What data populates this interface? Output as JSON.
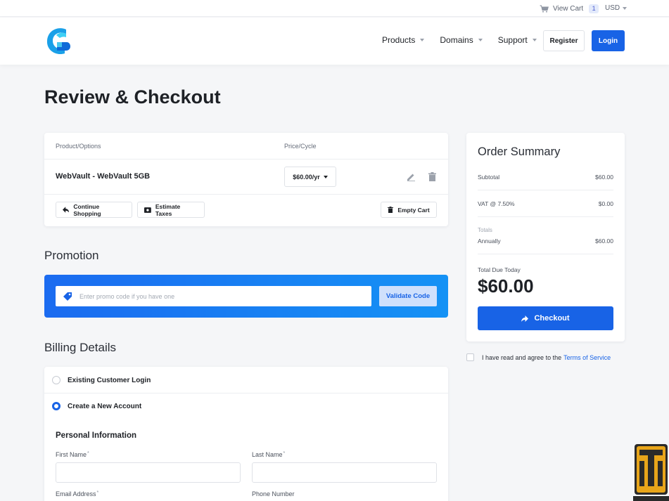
{
  "topbar": {
    "cart_label": "View Cart",
    "cart_count": "1",
    "currency": "USD"
  },
  "header": {
    "nav": [
      {
        "label": "Products"
      },
      {
        "label": "Domains"
      },
      {
        "label": "Support"
      }
    ],
    "register_label": "Register",
    "login_label": "Login"
  },
  "page": {
    "title": "Review & Checkout"
  },
  "cart": {
    "col_product": "Product/Options",
    "col_price": "Price/Cycle",
    "item_name": "WebVault - WebVault 5GB",
    "item_price": "$60.00/yr",
    "continue_label": "Continue Shopping",
    "estimate_label": "Estimate Taxes",
    "empty_label": "Empty Cart"
  },
  "promotion": {
    "title": "Promotion",
    "placeholder": "Enter promo code if you have one",
    "validate_label": "Validate Code"
  },
  "billing": {
    "title": "Billing Details",
    "existing_label": "Existing Customer Login",
    "new_label": "Create a New Account",
    "personal_title": "Personal Information",
    "first_name_label": "First Name",
    "last_name_label": "Last Name",
    "email_label": "Email Address",
    "phone_label": "Phone Number",
    "required_mark": "*"
  },
  "summary": {
    "title": "Order Summary",
    "subtotal_label": "Subtotal",
    "subtotal_value": "$60.00",
    "vat_label": "VAT @ 7.50%",
    "vat_value": "$0.00",
    "totals_label": "Totals",
    "annually_label": "Annually",
    "annually_value": "$60.00",
    "due_label": "Total Due Today",
    "due_amount": "$60.00",
    "checkout_label": "Checkout"
  },
  "tos": {
    "text": "I have read and agree to the",
    "link": "Terms of Service"
  },
  "colors": {
    "primary": "#1863e6",
    "promo_gradient_start": "#1b6bf0",
    "promo_gradient_end": "#1592f5",
    "page_bg": "#f5f6f8"
  },
  "icons": [
    "cart-icon",
    "caret-down-icon",
    "edit-icon",
    "trash-icon",
    "arrow-left-icon",
    "tax-icon",
    "tag-icon",
    "arrow-right-icon"
  ]
}
